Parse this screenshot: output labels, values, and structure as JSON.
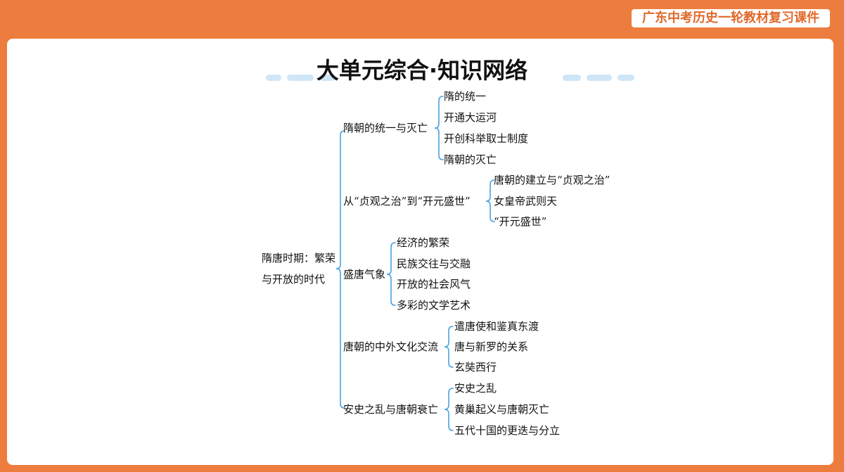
{
  "header": {
    "badge": "广东中考历史一轮教材复习课件"
  },
  "title": "大单元综合·知识网络",
  "root": {
    "line1": "隋唐时期：繁荣",
    "line2": "与开放的时代"
  },
  "branches": [
    {
      "label": "隋朝的统一与灭亡",
      "children": [
        "隋的统一",
        "开通大运河",
        "开创科举取士制度",
        "隋朝的灭亡"
      ]
    },
    {
      "label": "从“贞观之治”到“开元盛世”",
      "children": [
        "唐朝的建立与“贞观之治”",
        "女皇帝武则天",
        "“开元盛世”"
      ]
    },
    {
      "label": "盛唐气象",
      "children": [
        "经济的繁荣",
        "民族交往与交融",
        "开放的社会风气",
        "多彩的文学艺术"
      ]
    },
    {
      "label": "唐朝的中外文化交流",
      "children": [
        "遣唐使和鉴真东渡",
        "唐与新罗的关系",
        "玄奘西行"
      ]
    },
    {
      "label": "安史之乱与唐朝衰亡",
      "children": [
        "安史之乱",
        "黄巢起义与唐朝灭亡",
        "五代十国的更迭与分立"
      ]
    }
  ],
  "colors": {
    "frame": "#ec7d3f",
    "bracket": "#4aa3df",
    "pill": "#cfe6f7"
  }
}
